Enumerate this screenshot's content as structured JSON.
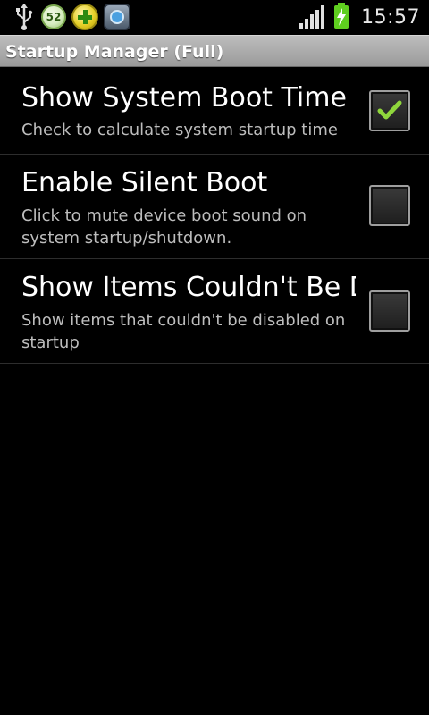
{
  "status_bar": {
    "notification_badge": "52",
    "time": "15:57",
    "icons": [
      "usb-icon",
      "task-killer-icon",
      "add-icon",
      "shield-icon",
      "signal-icon",
      "battery-charging-icon"
    ],
    "battery_color": "#5fcf1f"
  },
  "title_bar": {
    "title": "Startup Manager (Full)"
  },
  "preferences": [
    {
      "title": "Show System Boot Time",
      "summary": "Check to calculate system startup time",
      "checked": true
    },
    {
      "title": "Enable Silent Boot",
      "summary": "Click to mute device boot sound on system startup/shutdown.",
      "checked": false
    },
    {
      "title": "Show Items Couldn't Be Disabled",
      "summary": "Show items that couldn't be disabled on startup",
      "checked": false
    }
  ],
  "colors": {
    "background": "#000000",
    "check_mark": "#8fd63c",
    "title_bar": "#a8a8a8"
  }
}
